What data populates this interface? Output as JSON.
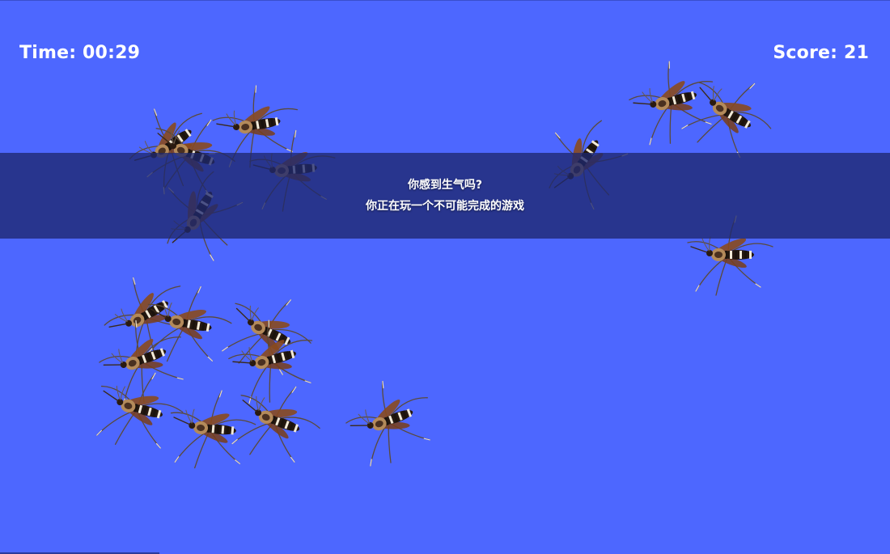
{
  "hud": {
    "time_text": "Time: 00:29",
    "score_text": "Score: 21"
  },
  "banner": {
    "line1": "你感到生气吗?",
    "line2": "你正在玩一个不可能完成的游戏"
  },
  "colors": {
    "background": "#4d67ff",
    "banner": "#1e286e",
    "text": "#ffffff"
  },
  "sprite": "mosquito-icon"
}
